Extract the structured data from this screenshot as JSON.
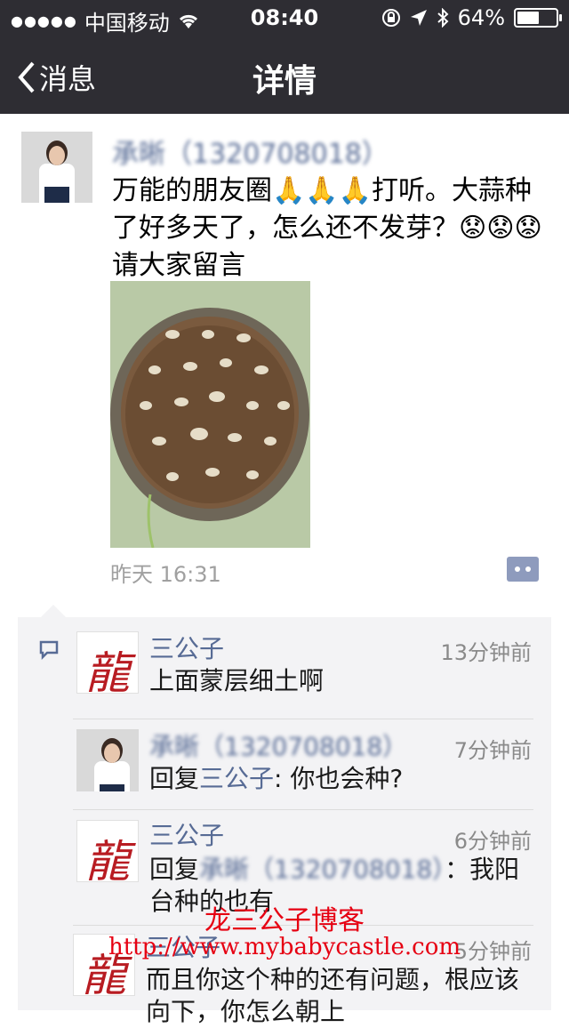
{
  "status_bar": {
    "signal_dots": "●●●●●",
    "carrier": "中国移动",
    "time": "08:40",
    "battery": "64%",
    "battery_level": 0.64
  },
  "nav": {
    "back_label": "消息",
    "title": "详情"
  },
  "post": {
    "author": "承晰（1320708018）",
    "text": "万能的朋友圈🙏🙏🙏打听。大蒜种了好多天了，怎么还不发芽？😟😟😟请大家留言",
    "time": "昨天 16:31"
  },
  "comments": [
    {
      "name": "三公子",
      "time": "13分钟前",
      "text": "上面蒙层细土啊"
    },
    {
      "name": "承晰（1320708018）",
      "time": "7分钟前",
      "reply_prefix": "回复",
      "reply_to": "三公子",
      "reply_suffix": ": 你也会种?"
    },
    {
      "name": "三公子",
      "time": "6分钟前",
      "reply_prefix": "回复",
      "reply_to": "承晰（1320708018）",
      "text": "：我阳台种的也有"
    },
    {
      "name": "三公子",
      "time": "5分钟前",
      "text": "而且你这个种的还有问题，根应该向下，你怎么朝上"
    }
  ],
  "watermark": {
    "line1": "龙三公子博客",
    "line2": "http://www.mybabycastle.com"
  },
  "colors": {
    "nav_bg": "#2e2d33",
    "link": "#576b95",
    "watermark": "#e60012"
  }
}
